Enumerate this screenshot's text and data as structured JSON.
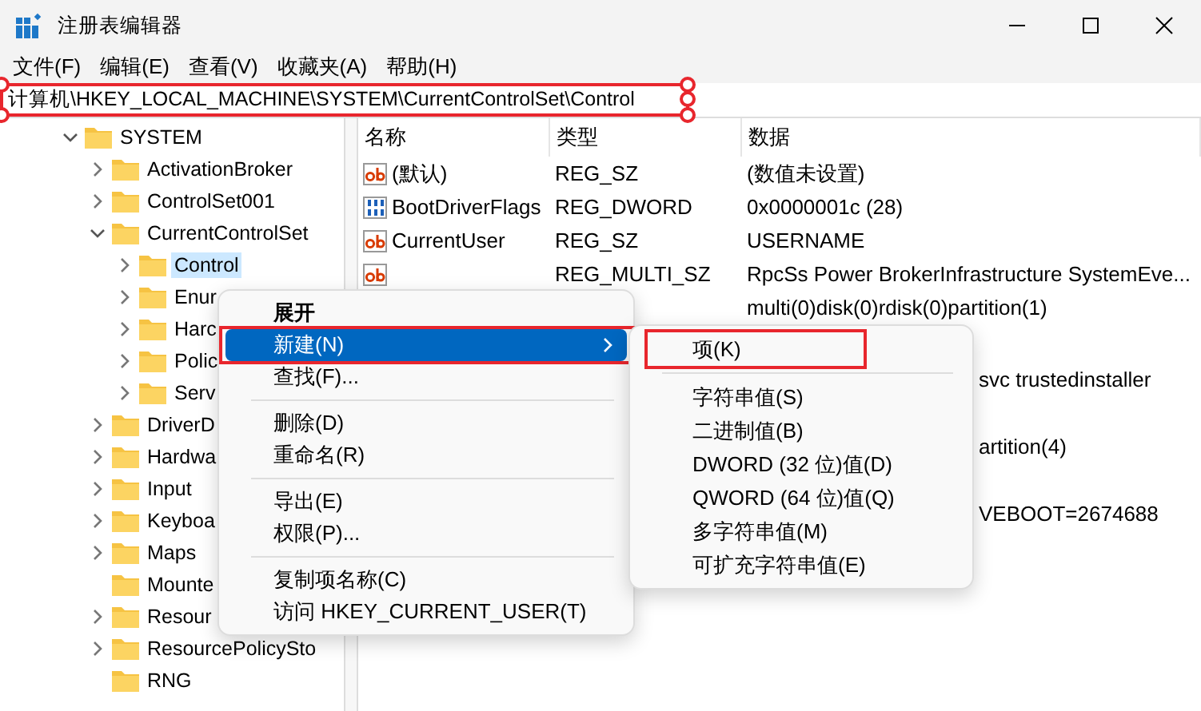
{
  "window": {
    "title": "注册表编辑器"
  },
  "menu_bar": [
    "文件(F)",
    "编辑(E)",
    "查看(V)",
    "收藏夹(A)",
    "帮助(H)"
  ],
  "address_bar": {
    "value": "计算机\\HKEY_LOCAL_MACHINE\\SYSTEM\\CurrentControlSet\\Control",
    "annotated": true
  },
  "tree": [
    {
      "label": "SYSTEM",
      "expandable": true,
      "expanded": true,
      "selected": false,
      "children": [
        {
          "label": "ActivationBroker",
          "expandable": true,
          "expanded": false,
          "selected": false
        },
        {
          "label": "ControlSet001",
          "expandable": true,
          "expanded": false,
          "selected": false
        },
        {
          "label": "CurrentControlSet",
          "expandable": true,
          "expanded": true,
          "selected": false,
          "children": [
            {
              "label": "Control",
              "expandable": true,
              "expanded": false,
              "selected": true
            },
            {
              "label": "Enur",
              "expandable": true,
              "expanded": false,
              "selected": false
            },
            {
              "label": "Harc",
              "expandable": true,
              "expanded": false,
              "selected": false
            },
            {
              "label": "Polic",
              "expandable": true,
              "expanded": false,
              "selected": false
            },
            {
              "label": "Serv",
              "expandable": true,
              "expanded": false,
              "selected": false
            }
          ]
        },
        {
          "label": "DriverD",
          "expandable": true,
          "expanded": false,
          "selected": false
        },
        {
          "label": "Hardwa",
          "expandable": true,
          "expanded": false,
          "selected": false
        },
        {
          "label": "Input",
          "expandable": true,
          "expanded": false,
          "selected": false
        },
        {
          "label": "Keyboa",
          "expandable": true,
          "expanded": false,
          "selected": false
        },
        {
          "label": "Maps",
          "expandable": true,
          "expanded": false,
          "selected": false
        },
        {
          "label": "Mounte",
          "expandable": false,
          "expanded": false,
          "selected": false
        },
        {
          "label": "Resour",
          "expandable": true,
          "expanded": false,
          "selected": false
        },
        {
          "label": "ResourcePolicySto",
          "expandable": true,
          "expanded": false,
          "selected": false
        },
        {
          "label": "RNG",
          "expandable": false,
          "expanded": false,
          "selected": false
        }
      ]
    }
  ],
  "table": {
    "columns": [
      "名称",
      "类型",
      "数据"
    ],
    "rows": [
      {
        "kind": "string",
        "name": "(默认)",
        "type": "REG_SZ",
        "data": "(数值未设置)"
      },
      {
        "kind": "binary",
        "name": "BootDriverFlags",
        "type": "REG_DWORD",
        "data": "0x0000001c (28)"
      },
      {
        "kind": "string",
        "name": "CurrentUser",
        "type": "REG_SZ",
        "data": "USERNAME"
      },
      {
        "kind": "string",
        "type": "REG_MULTI_SZ",
        "data": "RpcSs Power BrokerInfrastructure SystemEve..."
      },
      {
        "kind": "data",
        "data": "multi(0)disk(0)rdisk(0)partition(1)"
      },
      {
        "kind": "tail",
        "data": "svc trustedinstaller"
      },
      {
        "kind": "tail",
        "data": "artition(4)"
      },
      {
        "kind": "tail",
        "data": "VEBOOT=2674688"
      }
    ]
  },
  "context_menu": [
    {
      "kind": "item",
      "label": "展开",
      "default": true,
      "selected": false,
      "submenu": false,
      "annotated": false
    },
    {
      "kind": "item",
      "label": "新建(N)",
      "default": false,
      "selected": true,
      "submenu": true,
      "annotated": true
    },
    {
      "kind": "item",
      "label": "查找(F)...",
      "default": false,
      "selected": false,
      "submenu": false,
      "annotated": false
    },
    {
      "kind": "separator"
    },
    {
      "kind": "item",
      "label": "删除(D)",
      "default": false,
      "selected": false,
      "submenu": false,
      "annotated": false
    },
    {
      "kind": "item",
      "label": "重命名(R)",
      "default": false,
      "selected": false,
      "submenu": false,
      "annotated": false
    },
    {
      "kind": "separator"
    },
    {
      "kind": "item",
      "label": "导出(E)",
      "default": false,
      "selected": false,
      "submenu": false,
      "annotated": false
    },
    {
      "kind": "item",
      "label": "权限(P)...",
      "default": false,
      "selected": false,
      "submenu": false,
      "annotated": false
    },
    {
      "kind": "separator"
    },
    {
      "kind": "item",
      "label": "复制项名称(C)",
      "default": false,
      "selected": false,
      "submenu": false,
      "annotated": false
    },
    {
      "kind": "item",
      "label": "访问 HKEY_CURRENT_USER(T)",
      "default": false,
      "selected": false,
      "submenu": false,
      "annotated": false
    }
  ],
  "submenu": [
    {
      "kind": "item",
      "label": "项(K)",
      "annotated": true
    },
    {
      "kind": "separator"
    },
    {
      "kind": "item",
      "label": "字符串值(S)",
      "annotated": false
    },
    {
      "kind": "item",
      "label": "二进制值(B)",
      "annotated": false
    },
    {
      "kind": "item",
      "label": "DWORD (32 位)值(D)",
      "annotated": false
    },
    {
      "kind": "item",
      "label": "QWORD (64 位)值(Q)",
      "annotated": false
    },
    {
      "kind": "item",
      "label": "多字符串值(M)",
      "annotated": false
    },
    {
      "kind": "item",
      "label": "可扩充字符串值(E)",
      "annotated": false
    }
  ]
}
